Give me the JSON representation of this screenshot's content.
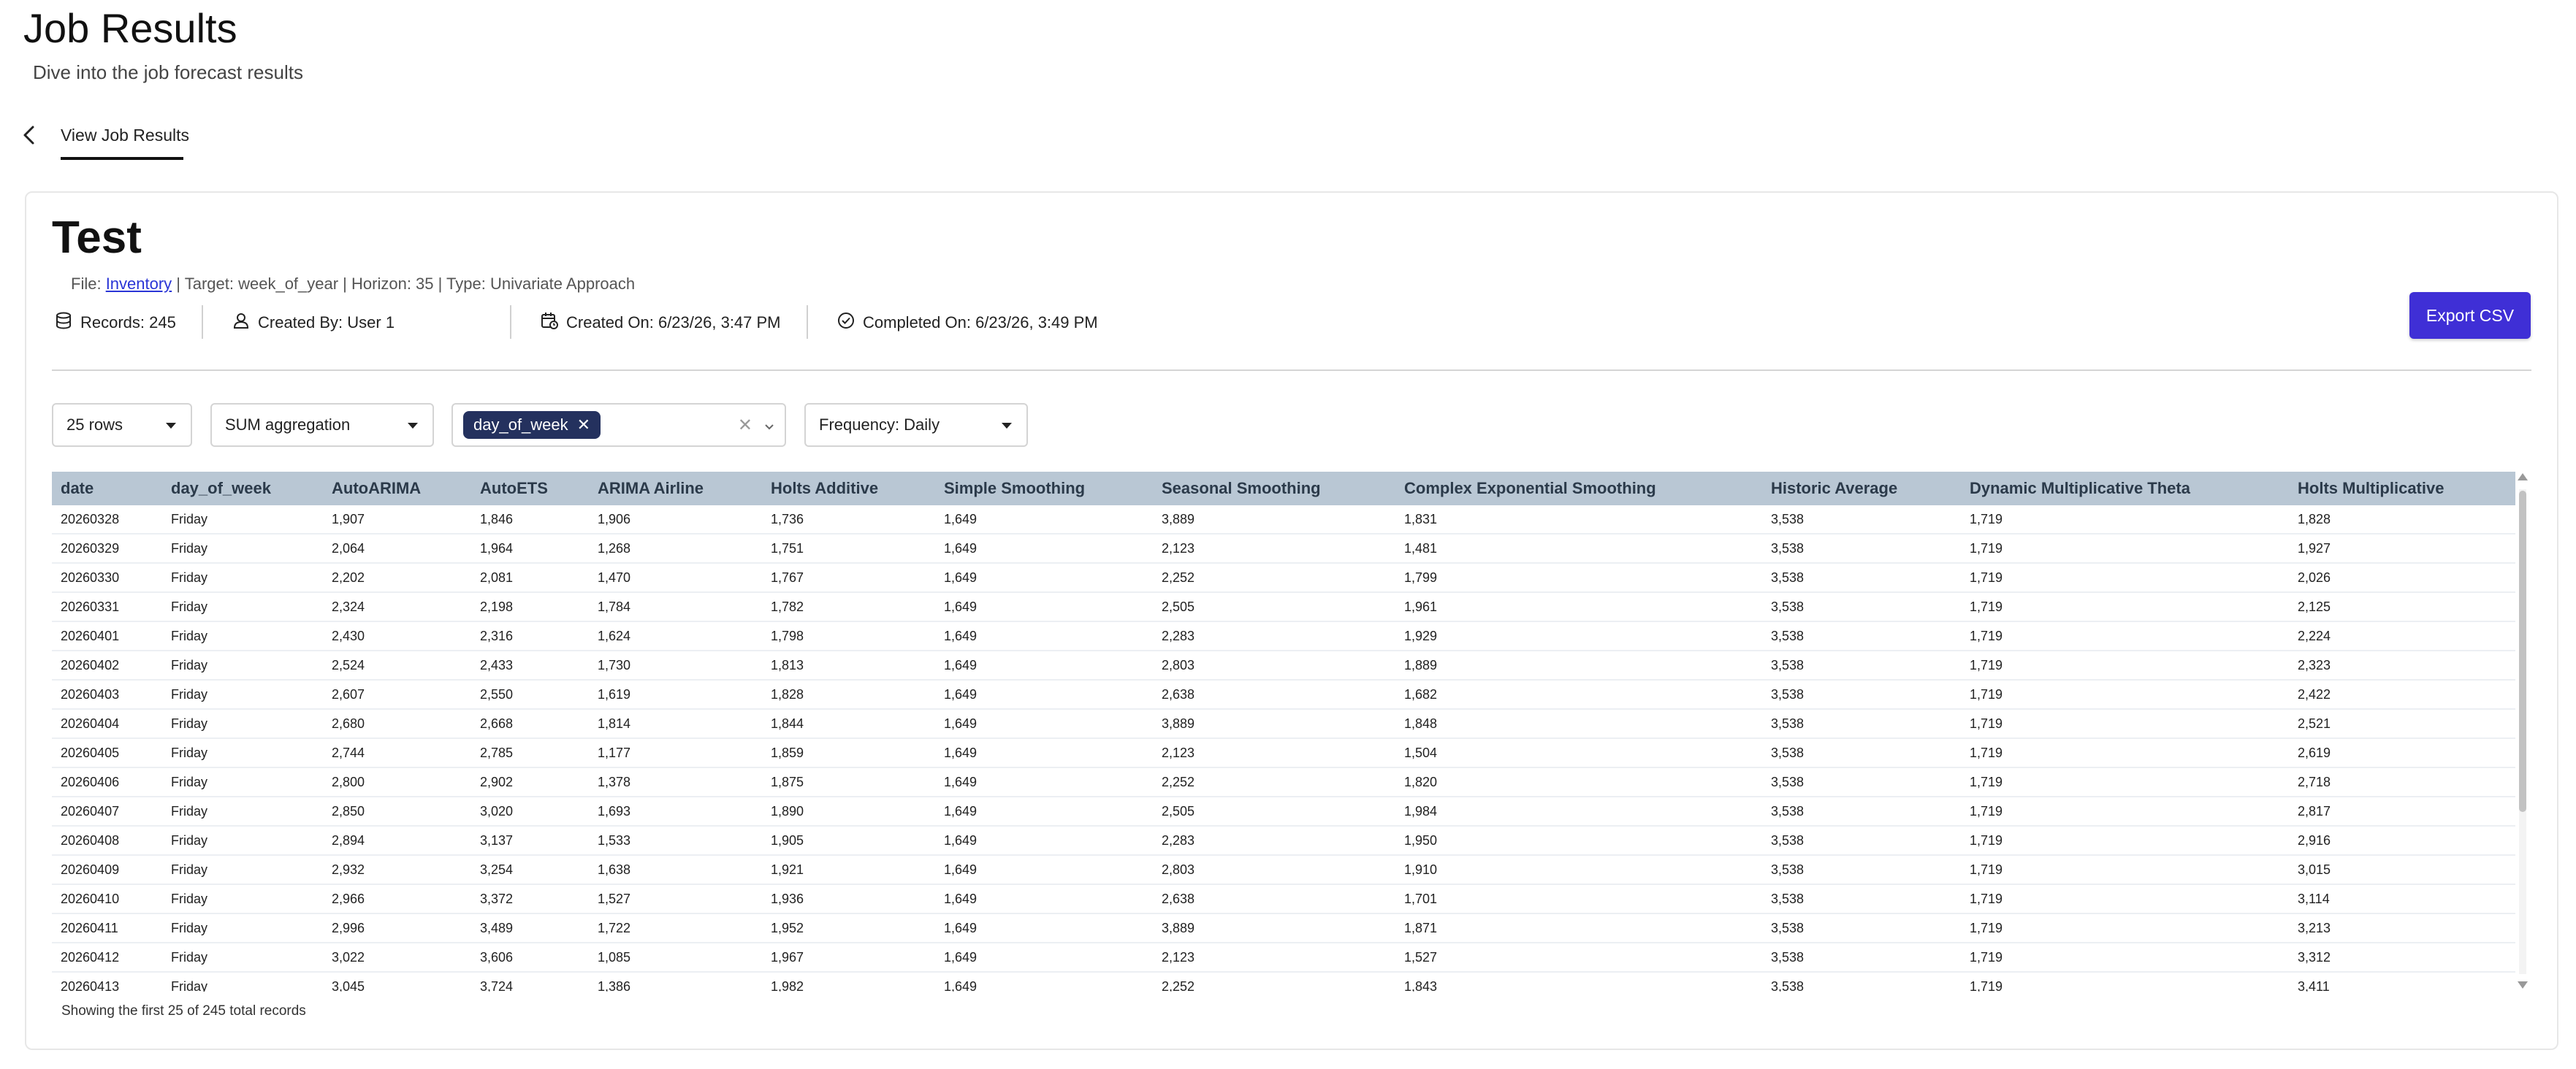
{
  "header": {
    "title": "Job Results",
    "subtitle": "Dive into the job forecast results",
    "tab_label": "View Job Results"
  },
  "job": {
    "title": "Test",
    "file_prefix": "File: ",
    "file_name": "Inventory",
    "meta_rest": " | Target: week_of_year | Horizon: 35 | Type: Univariate Approach",
    "records": "Records: 245",
    "created_by": "Created By: User 1",
    "created_on": "Created On: 6/23/26, 3:47 PM",
    "completed_on": "Completed On: 6/23/26, 3:49 PM",
    "export_label": "Export CSV"
  },
  "controls": {
    "rows": "25 rows",
    "aggregation": "SUM aggregation",
    "group_chip": "day_of_week",
    "frequency": "Frequency: Daily"
  },
  "table": {
    "columns": [
      "date",
      "day_of_week",
      "AutoARIMA",
      "AutoETS",
      "ARIMA Airline",
      "Holts Additive",
      "Simple Smoothing",
      "Seasonal Smoothing",
      "Complex Exponential Smoothing",
      "Historic Average",
      "Dynamic Multiplicative Theta",
      "Holts Multiplicative"
    ],
    "rows": [
      [
        "20260328",
        "Friday",
        "1,907",
        "1,846",
        "1,906",
        "1,736",
        "1,649",
        "3,889",
        "1,831",
        "3,538",
        "1,719",
        "1,828"
      ],
      [
        "20260329",
        "Friday",
        "2,064",
        "1,964",
        "1,268",
        "1,751",
        "1,649",
        "2,123",
        "1,481",
        "3,538",
        "1,719",
        "1,927"
      ],
      [
        "20260330",
        "Friday",
        "2,202",
        "2,081",
        "1,470",
        "1,767",
        "1,649",
        "2,252",
        "1,799",
        "3,538",
        "1,719",
        "2,026"
      ],
      [
        "20260331",
        "Friday",
        "2,324",
        "2,198",
        "1,784",
        "1,782",
        "1,649",
        "2,505",
        "1,961",
        "3,538",
        "1,719",
        "2,125"
      ],
      [
        "20260401",
        "Friday",
        "2,430",
        "2,316",
        "1,624",
        "1,798",
        "1,649",
        "2,283",
        "1,929",
        "3,538",
        "1,719",
        "2,224"
      ],
      [
        "20260402",
        "Friday",
        "2,524",
        "2,433",
        "1,730",
        "1,813",
        "1,649",
        "2,803",
        "1,889",
        "3,538",
        "1,719",
        "2,323"
      ],
      [
        "20260403",
        "Friday",
        "2,607",
        "2,550",
        "1,619",
        "1,828",
        "1,649",
        "2,638",
        "1,682",
        "3,538",
        "1,719",
        "2,422"
      ],
      [
        "20260404",
        "Friday",
        "2,680",
        "2,668",
        "1,814",
        "1,844",
        "1,649",
        "3,889",
        "1,848",
        "3,538",
        "1,719",
        "2,521"
      ],
      [
        "20260405",
        "Friday",
        "2,744",
        "2,785",
        "1,177",
        "1,859",
        "1,649",
        "2,123",
        "1,504",
        "3,538",
        "1,719",
        "2,619"
      ],
      [
        "20260406",
        "Friday",
        "2,800",
        "2,902",
        "1,378",
        "1,875",
        "1,649",
        "2,252",
        "1,820",
        "3,538",
        "1,719",
        "2,718"
      ],
      [
        "20260407",
        "Friday",
        "2,850",
        "3,020",
        "1,693",
        "1,890",
        "1,649",
        "2,505",
        "1,984",
        "3,538",
        "1,719",
        "2,817"
      ],
      [
        "20260408",
        "Friday",
        "2,894",
        "3,137",
        "1,533",
        "1,905",
        "1,649",
        "2,283",
        "1,950",
        "3,538",
        "1,719",
        "2,916"
      ],
      [
        "20260409",
        "Friday",
        "2,932",
        "3,254",
        "1,638",
        "1,921",
        "1,649",
        "2,803",
        "1,910",
        "3,538",
        "1,719",
        "3,015"
      ],
      [
        "20260410",
        "Friday",
        "2,966",
        "3,372",
        "1,527",
        "1,936",
        "1,649",
        "2,638",
        "1,701",
        "3,538",
        "1,719",
        "3,114"
      ],
      [
        "20260411",
        "Friday",
        "2,996",
        "3,489",
        "1,722",
        "1,952",
        "1,649",
        "3,889",
        "1,871",
        "3,538",
        "1,719",
        "3,213"
      ],
      [
        "20260412",
        "Friday",
        "3,022",
        "3,606",
        "1,085",
        "1,967",
        "1,649",
        "2,123",
        "1,527",
        "3,538",
        "1,719",
        "3,312"
      ],
      [
        "20260413",
        "Friday",
        "3,045",
        "3,724",
        "1,386",
        "1,982",
        "1,649",
        "2,252",
        "1,843",
        "3,538",
        "1,719",
        "3,411"
      ]
    ],
    "footer": "Showing the first 25 of 245 total records"
  },
  "colors": {
    "accent": "#3f2fd6",
    "chip": "#24315e",
    "table_header": "#b9c7d4",
    "link": "#2a35d6"
  }
}
